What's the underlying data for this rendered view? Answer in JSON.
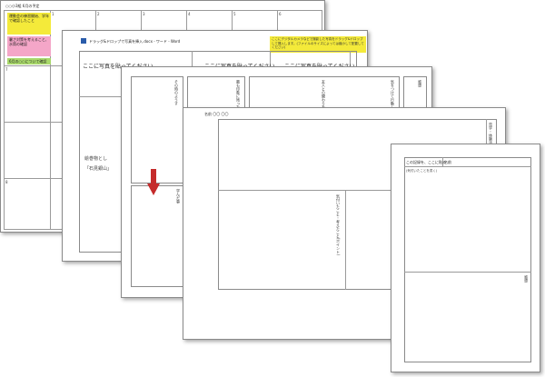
{
  "sheet1": {
    "title": "○○小3組 6月の予定",
    "day_numbers": [
      "1",
      "2",
      "3",
      "4",
      "5",
      "6"
    ],
    "row2_number": "7",
    "row3_number": "8",
    "sticky_yellow": "運動会の練習開始、学年で確認したこと",
    "sticky_pink": "暑さ対策を考えること、水筒の確認",
    "sticky_green": "6月の○○について確認"
  },
  "sheet2": {
    "file_label": "ドラッグ&ドロップで写真を挿入.docx - ワード - Word",
    "note": "ここにデジタルカメラなどで撮影した写真をドラッグ&ドロップして挿入します。(ファイルのサイズによっては縮小して配置してください)",
    "photo_placeholders": [
      "ここに写真を貼ってください",
      "ここに写真を貼ってください",
      "ここに写真を貼ってください"
    ],
    "left_label_1": "絵巻物とし",
    "left_label_2": "「石見銀山」"
  },
  "sheet3": {
    "vlabels": [
      "その時のようす",
      "最も印象に残った場面",
      "友人との関わりを振り返る",
      "気をつけて行動したこと",
      "学んだ事",
      "感想"
    ]
  },
  "sheet4": {
    "header": "名前 〇〇 〇〇",
    "vlabel_top": "見学・体験活動の記録",
    "vlabel_mid": "気付いたこと・考えたこと(ポイント)"
  },
  "sheet5": {
    "header_left": "この記録を、ここに貼る",
    "header_right": "名前",
    "sub_label": "(気付いたことを書く)",
    "side_label": "感想"
  },
  "colors": {
    "sticky_yellow": "#f4ea3a",
    "sticky_pink": "#f4a6c8",
    "sticky_green": "#a8d86a",
    "arrow": "#c52b2b"
  }
}
